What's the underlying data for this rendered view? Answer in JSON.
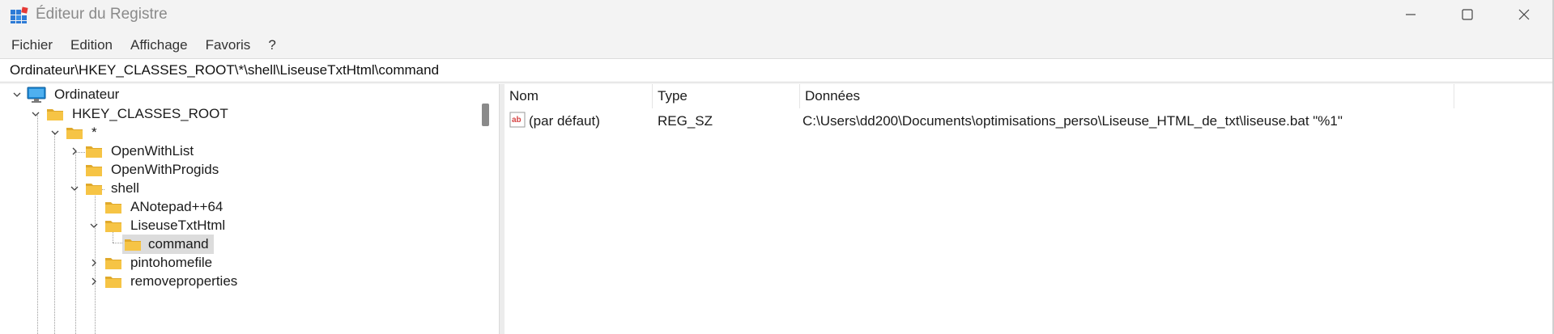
{
  "window": {
    "title": "Éditeur du Registre",
    "controls": {
      "minimize_icon": "minimize-icon",
      "maximize_icon": "maximize-icon",
      "close_icon": "close-icon"
    }
  },
  "menu": {
    "items": [
      {
        "label": "Fichier"
      },
      {
        "label": "Edition"
      },
      {
        "label": "Affichage"
      },
      {
        "label": "Favoris"
      },
      {
        "label": "?"
      }
    ]
  },
  "address": {
    "path": "Ordinateur\\HKEY_CLASSES_ROOT\\*\\shell\\LiseuseTxtHtml\\command"
  },
  "tree": {
    "nodes": [
      {
        "label": "Ordinateur",
        "icon": "computer-icon",
        "expander": "expanded"
      },
      {
        "label": "HKEY_CLASSES_ROOT",
        "icon": "folder-icon",
        "expander": "expanded"
      },
      {
        "label": "*",
        "icon": "folder-icon",
        "expander": "expanded"
      },
      {
        "label": "OpenWithList",
        "icon": "folder-icon",
        "expander": "collapsed"
      },
      {
        "label": "OpenWithProgids",
        "icon": "folder-icon",
        "expander": "none"
      },
      {
        "label": "shell",
        "icon": "folder-icon",
        "expander": "expanded"
      },
      {
        "label": "ANotepad++64",
        "icon": "folder-icon",
        "expander": "none"
      },
      {
        "label": "LiseuseTxtHtml",
        "icon": "folder-icon",
        "expander": "expanded"
      },
      {
        "label": "command",
        "icon": "folder-icon",
        "expander": "none",
        "selected": true
      },
      {
        "label": "pintohomefile",
        "icon": "folder-icon",
        "expander": "collapsed"
      },
      {
        "label": "removeproperties",
        "icon": "folder-icon",
        "expander": "collapsed"
      }
    ]
  },
  "values": {
    "columns": {
      "name": "Nom",
      "type": "Type",
      "data": "Données"
    },
    "rows": [
      {
        "icon": "string-value-icon",
        "name": "(par défaut)",
        "type": "REG_SZ",
        "data": "C:\\Users\\dd200\\Documents\\optimisations_perso\\Liseuse_HTML_de_txt\\liseuse.bat \"%1\""
      }
    ]
  },
  "colors": {
    "folder": "#f6c445",
    "folder_dark": "#e0a92b",
    "computer": "#1e88d4",
    "selection": "#dcdcdc"
  }
}
